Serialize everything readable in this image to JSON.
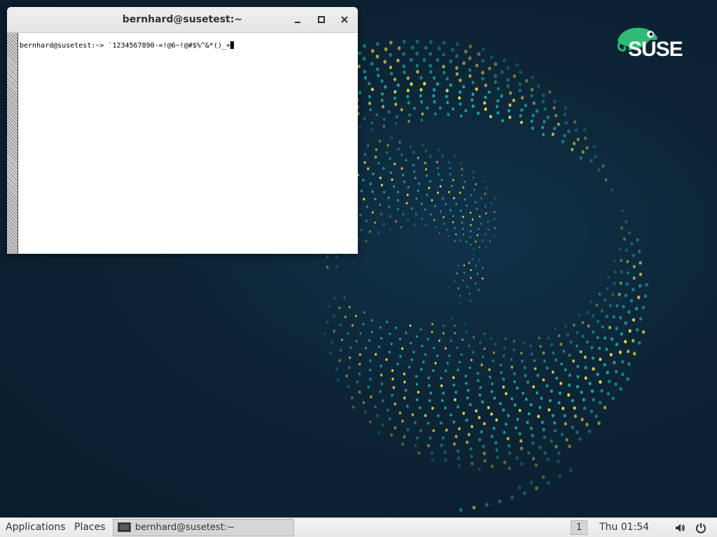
{
  "window": {
    "title": "bernhard@susetest:~",
    "prompt": "bernhard@susetest:~> ",
    "command": "`1234567890-=!@6~!@#$%^&*()_+"
  },
  "logo": {
    "wordmark": "SUSE",
    "icon": "chameleon-icon"
  },
  "taskbar": {
    "applications_label": "Applications",
    "places_label": "Places",
    "task_label": "bernhard@susetest:~",
    "workspace": "1",
    "clock": "Thu 01:54"
  },
  "colors": {
    "desktop": "#0c2233",
    "accent_green": "#30ba78",
    "dot_teal": "#1aa39a",
    "dot_yellow": "#d6d84a"
  }
}
